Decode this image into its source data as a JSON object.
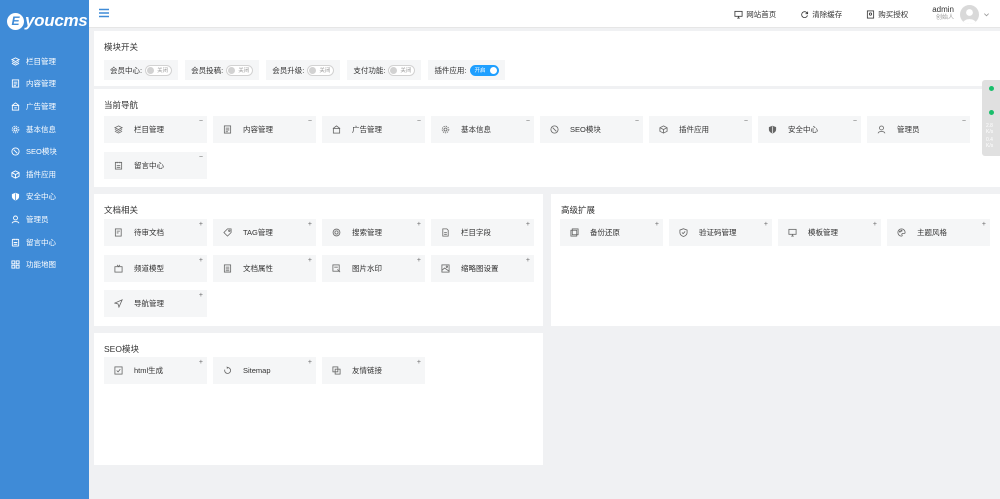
{
  "brand": {
    "mark": "E",
    "name": "youcms"
  },
  "sidebar": {
    "items": [
      {
        "label": "栏目管理",
        "icon": "layers-icon"
      },
      {
        "label": "内容管理",
        "icon": "document-icon"
      },
      {
        "label": "广告管理",
        "icon": "ad-icon"
      },
      {
        "label": "基本信息",
        "icon": "gear-icon"
      },
      {
        "label": "SEO模块",
        "icon": "compass-icon"
      },
      {
        "label": "插件应用",
        "icon": "cube-icon"
      },
      {
        "label": "安全中心",
        "icon": "shield-icon"
      },
      {
        "label": "管理员",
        "icon": "user-icon"
      },
      {
        "label": "留言中心",
        "icon": "message-icon"
      },
      {
        "label": "功能地图",
        "icon": "grid-icon"
      }
    ]
  },
  "topbar": {
    "home_label": "网站首页",
    "clear_label": "清除缓存",
    "auth_label": "购买授权",
    "user_name": "admin",
    "user_role": "创始人"
  },
  "module_switch": {
    "title": "模块开关",
    "items": [
      {
        "label": "会员中心:",
        "state": "关闭",
        "on": false
      },
      {
        "label": "会员投稿:",
        "state": "关闭",
        "on": false
      },
      {
        "label": "会员升级:",
        "state": "关闭",
        "on": false
      },
      {
        "label": "支付功能:",
        "state": "关闭",
        "on": false
      },
      {
        "label": "插件应用:",
        "state": "开启",
        "on": true
      }
    ]
  },
  "current_nav": {
    "title": "当前导航",
    "items": [
      {
        "label": "栏目管理",
        "mark": "−"
      },
      {
        "label": "内容管理",
        "mark": "−"
      },
      {
        "label": "广告管理",
        "mark": "−"
      },
      {
        "label": "基本信息",
        "mark": "−"
      },
      {
        "label": "SEO模块",
        "mark": "−"
      },
      {
        "label": "插件应用",
        "mark": "−"
      },
      {
        "label": "安全中心",
        "mark": "−"
      },
      {
        "label": "管理员",
        "mark": "−"
      },
      {
        "label": "留言中心",
        "mark": "−"
      }
    ]
  },
  "doc_related": {
    "title": "文档相关",
    "items": [
      {
        "label": "待审文档",
        "mark": "+"
      },
      {
        "label": "TAG管理",
        "mark": "+"
      },
      {
        "label": "搜索管理",
        "mark": "+"
      },
      {
        "label": "栏目字段",
        "mark": "+"
      },
      {
        "label": "频道模型",
        "mark": "+"
      },
      {
        "label": "文档属性",
        "mark": "+"
      },
      {
        "label": "图片水印",
        "mark": "+"
      },
      {
        "label": "缩略图设置",
        "mark": "+"
      },
      {
        "label": "导航管理",
        "mark": "+"
      }
    ]
  },
  "advanced": {
    "title": "高级扩展",
    "items": [
      {
        "label": "备份还原",
        "mark": "+"
      },
      {
        "label": "验证码管理",
        "mark": "+"
      },
      {
        "label": "模板管理",
        "mark": "+"
      },
      {
        "label": "主题风格",
        "mark": "+"
      }
    ]
  },
  "seo": {
    "title": "SEO模块",
    "items": [
      {
        "label": "html生成",
        "mark": "+"
      },
      {
        "label": "Sitemap",
        "mark": "+"
      },
      {
        "label": "友情链接",
        "mark": "+"
      }
    ]
  },
  "side_widget": {
    "line1": "2.8",
    "line2": "K/s",
    "line3": "0.4",
    "line4": "K/s"
  },
  "colors": {
    "sidebar": "#3f8bd7",
    "accent": "#1e9fff",
    "panel_bg": "#ffffff",
    "card_bg": "#f5f6f7"
  }
}
